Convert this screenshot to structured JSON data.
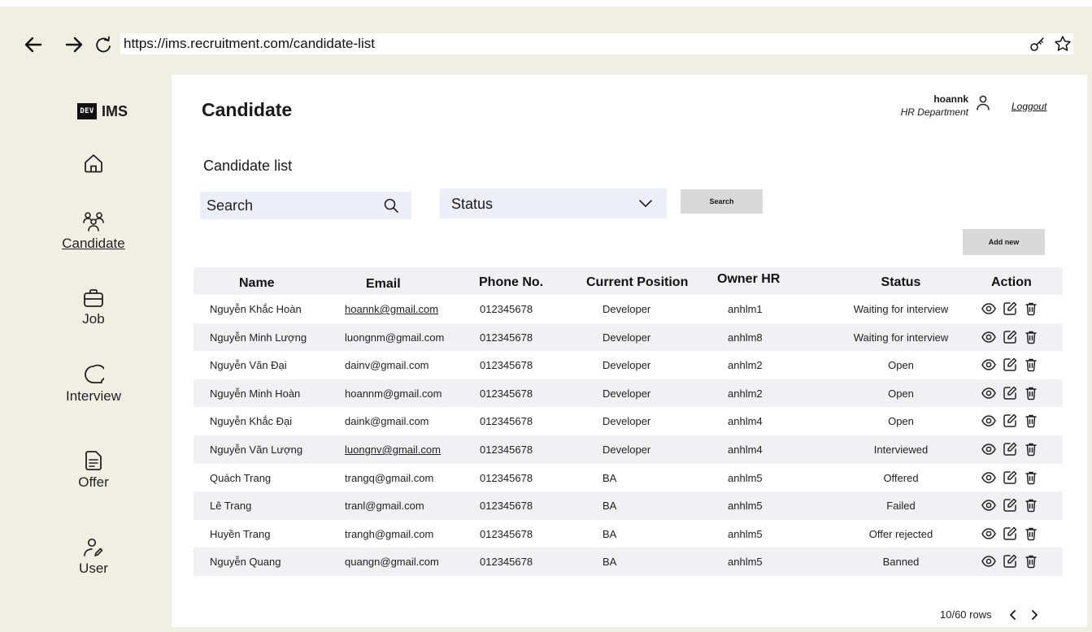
{
  "browser": {
    "url": "https://ims.recruitment.com/candidate-list"
  },
  "sidebar": {
    "logo_badge": "DEV",
    "logo_text": "IMS",
    "items": [
      {
        "label": "Candidate",
        "icon": "users-icon"
      },
      {
        "label": "Job",
        "icon": "briefcase-icon"
      },
      {
        "label": "Interview",
        "icon": "chat-icon"
      },
      {
        "label": "Offer",
        "icon": "document-icon"
      },
      {
        "label": "User",
        "icon": "user-edit-icon"
      }
    ]
  },
  "header": {
    "title": "Candidate",
    "user_name": "hoannk",
    "user_department": "HR Department",
    "logout": "Loggout"
  },
  "filters": {
    "section_title": "Candidate list",
    "search_placeholder": "Search",
    "status_placeholder": "Status",
    "search_button": "Search",
    "add_new_button": "Add new"
  },
  "table": {
    "columns": [
      "Name",
      "Email",
      "Phone No.",
      "Current Position",
      "Owner HR",
      "Status",
      "Action"
    ],
    "rows": [
      {
        "name": "Nguyễn Khắc Hoàn",
        "email": "hoannk@gmail.com",
        "phone": "012345678",
        "position": "Developer",
        "owner": "anhlm1",
        "status": "Waiting for interview"
      },
      {
        "name": "Nguyễn Minh Lượng",
        "email": "luongnm@gmail.com",
        "phone": "012345678",
        "position": "Developer",
        "owner": "anhlm8",
        "status": "Waiting for interview"
      },
      {
        "name": "Nguyễn Văn Đại",
        "email": "dainv@gmail.com",
        "phone": "012345678",
        "position": "Developer",
        "owner": "anhlm2",
        "status": "Open"
      },
      {
        "name": "Nguyễn Minh Hoàn",
        "email": "hoannm@gmail.com",
        "phone": "012345678",
        "position": "Developer",
        "owner": "anhlm2",
        "status": "Open"
      },
      {
        "name": "Nguyễn Khắc Đại",
        "email": "daink@gmail.com",
        "phone": "012345678",
        "position": "Developer",
        "owner": "anhlm4",
        "status": "Open"
      },
      {
        "name": "Nguyễn Văn Lượng",
        "email": "luongnv@gmail.com",
        "phone": "012345678",
        "position": "Developer",
        "owner": "anhlm4",
        "status": "Interviewed"
      },
      {
        "name": "Quách Trang",
        "email": "trangq@gmail.com",
        "phone": "012345678",
        "position": "BA",
        "owner": "anhlm5",
        "status": "Offered"
      },
      {
        "name": "Lê Trang",
        "email": "tranl@gmail.com",
        "phone": "012345678",
        "position": "BA",
        "owner": "anhlm5",
        "status": "Failed"
      },
      {
        "name": "Huyền Trang",
        "email": "trangh@gmail.com",
        "phone": "012345678",
        "position": "BA",
        "owner": "anhlm5",
        "status": "Offer rejected"
      },
      {
        "name": "Nguyễn Quang",
        "email": "quangn@gmail.com",
        "phone": "012345678",
        "position": "BA",
        "owner": "anhlm5",
        "status": "Banned"
      }
    ],
    "action_icons": [
      "eye-icon",
      "edit-icon",
      "trash-icon"
    ]
  },
  "pagination": {
    "summary": "10/60 rows"
  },
  "colors": {
    "page_background": "#eff0e3",
    "input_background": "#eceef8",
    "button_background": "#d9d9d9",
    "row_shade": "#f1f1f3"
  }
}
